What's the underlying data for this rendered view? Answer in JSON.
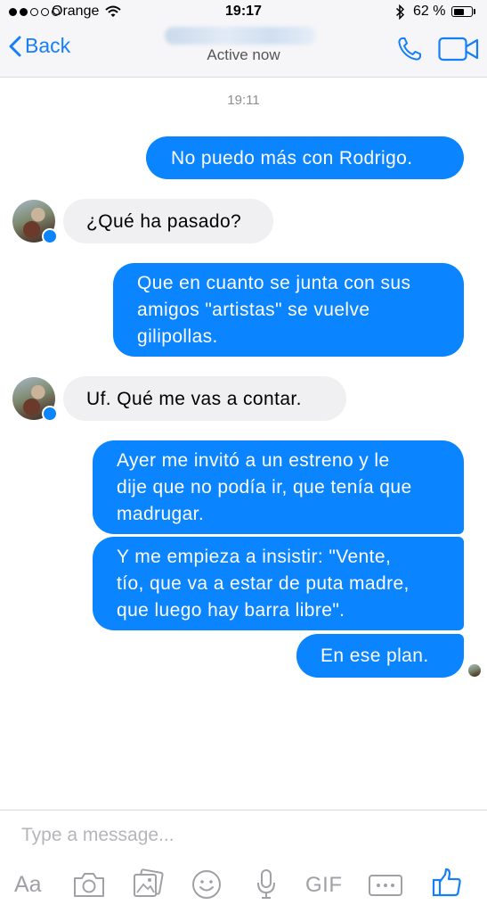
{
  "status_bar": {
    "carrier": "Orange",
    "time": "19:17",
    "battery_text": "62 %",
    "battery_level": 0.62,
    "signal_filled": 2,
    "signal_total": 5
  },
  "nav": {
    "back_label": "Back",
    "status": "Active now"
  },
  "conversation": {
    "timestamp": "19:11",
    "messages": [
      {
        "side": "out",
        "lines": [
          "No puedo más con Rodrigo."
        ]
      },
      {
        "side": "in",
        "lines": [
          "¿Qué ha pasado?"
        ]
      },
      {
        "side": "out",
        "lines": [
          "Que en cuanto se junta con sus",
          "amigos \"artistas\" se vuelve",
          "gilipollas."
        ]
      },
      {
        "side": "in",
        "lines": [
          "Uf. Qué me vas a contar."
        ]
      },
      {
        "side": "out",
        "lines": [
          "Ayer me invitó a un estreno y le",
          "dije que no podía ir, que tenía que",
          "madrugar."
        ]
      },
      {
        "side": "out",
        "lines": [
          "Y me empieza a insistir: \"Vente,",
          "tío, que va a estar de puta madre,",
          "que luego hay barra libre\"."
        ]
      },
      {
        "side": "out",
        "lines": [
          "En ese plan."
        ]
      }
    ]
  },
  "composer": {
    "placeholder": "Type a message..."
  },
  "toolbar": {
    "text_label": "Aa",
    "gif_label": "GIF"
  },
  "colors": {
    "accent": "#157efb",
    "outgoing_bubble": "#0a84ff",
    "incoming_bubble": "#f0f0f2",
    "toolbar_icon": "#a0a0a6"
  }
}
